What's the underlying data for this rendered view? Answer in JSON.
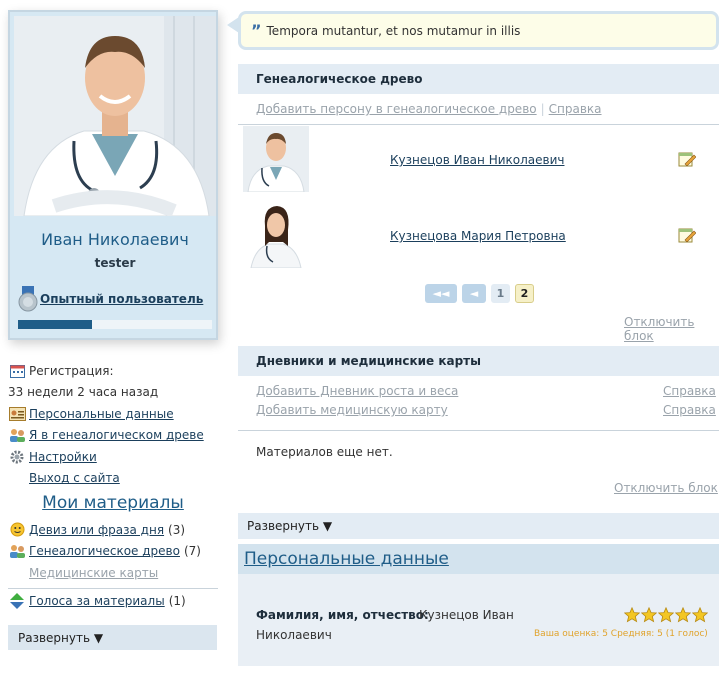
{
  "profile": {
    "name": "Иван Николаевич",
    "login": "tester",
    "rank": "Опытный пользователь",
    "progress_fraction": 0.38
  },
  "sidebar": {
    "registration_label": "Регистрация:",
    "registration_value": "33 недели 2 часа назад",
    "personal_data": "Персональные данные",
    "in_tree": "Я в генеалогическом древе",
    "settings": "Настройки",
    "logout": "Выход с сайта",
    "my_materials": "Мои материалы",
    "motto": "Девиз или фраза дня",
    "motto_count": "(3)",
    "tree": "Генеалогическое древо",
    "tree_count": "(7)",
    "medical_cards": "Медицинские карты",
    "votes": "Голоса за материалы",
    "votes_count": "(1)",
    "expand": "Развернуть ▼"
  },
  "quote": {
    "mark": "”",
    "text": "Tempora mutantur, et nos mutamur in illis"
  },
  "genealogy": {
    "title": "Генеалогическое древо",
    "add_link": "Добавить персону в генеалогическое древо",
    "help_link": "Справка",
    "persons": [
      {
        "name": "Кузнецов Иван Николаевич"
      },
      {
        "name": "Кузнецова Мария Петровна"
      }
    ],
    "pager": {
      "first": "◄◄",
      "prev": "◄",
      "page1": "1",
      "page2": "2"
    },
    "disable_block": "Отключить блок"
  },
  "diaries": {
    "title": "Дневники и медицинские карты",
    "add_growth": "Добавить Дневник роста и веса",
    "add_medcard": "Добавить медицинскую карту",
    "help1": "Справка",
    "help2": "Справка",
    "empty": "Материалов еще нет.",
    "disable_block": "Отключить блок"
  },
  "expand_right": "Развернуть ▼",
  "personal": {
    "title": "Персональные данные",
    "fio_label": "Фамилия, имя, отчество:",
    "fio_value_line1": "Кузнецов Иван",
    "fio_value_line2": "Николаевич",
    "rating_text": "Ваша оценка: 5 Средняя: 5 (1 голос)",
    "stars": 5
  },
  "colors": {
    "accent": "#1f5d88",
    "panel_bg": "#e3ecf4",
    "star": "#f3c623"
  }
}
